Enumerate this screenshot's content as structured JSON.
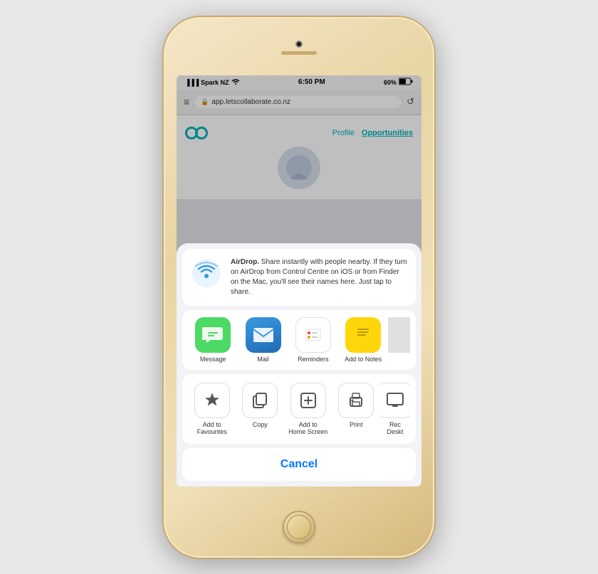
{
  "phone": {
    "status_bar": {
      "carrier": "Spark NZ",
      "signal": "▐▐▐",
      "wifi": "WiFi",
      "time": "6:50 PM",
      "battery": "60%"
    },
    "browser": {
      "url": "app.letscollaborate.co.nz",
      "reload_icon": "↺"
    },
    "web": {
      "nav_profile": "Profile",
      "nav_opportunities": "Opportunities"
    },
    "share_sheet": {
      "airdrop_title": "AirDrop.",
      "airdrop_text": " Share instantly with people nearby. If they turn on AirDrop from Control Centre on iOS or from Finder on the Mac, you'll see their names here. Just tap to share.",
      "app_icons": [
        {
          "id": "message",
          "label": "Message"
        },
        {
          "id": "mail",
          "label": "Mail"
        },
        {
          "id": "reminders",
          "label": "Reminders"
        },
        {
          "id": "notes",
          "label": "Add to Notes"
        }
      ],
      "actions": [
        {
          "id": "add-favourites",
          "label": "Add to\nFavourites",
          "icon": "★"
        },
        {
          "id": "copy",
          "label": "Copy",
          "icon": "⧉"
        },
        {
          "id": "add-home-screen",
          "label": "Add to\nHome Screen",
          "icon": "+"
        },
        {
          "id": "print",
          "label": "Print",
          "icon": "🖨"
        },
        {
          "id": "request-desktop",
          "label": "Rec\nDeskt...",
          "icon": "▭"
        }
      ],
      "cancel": "Cancel"
    }
  }
}
